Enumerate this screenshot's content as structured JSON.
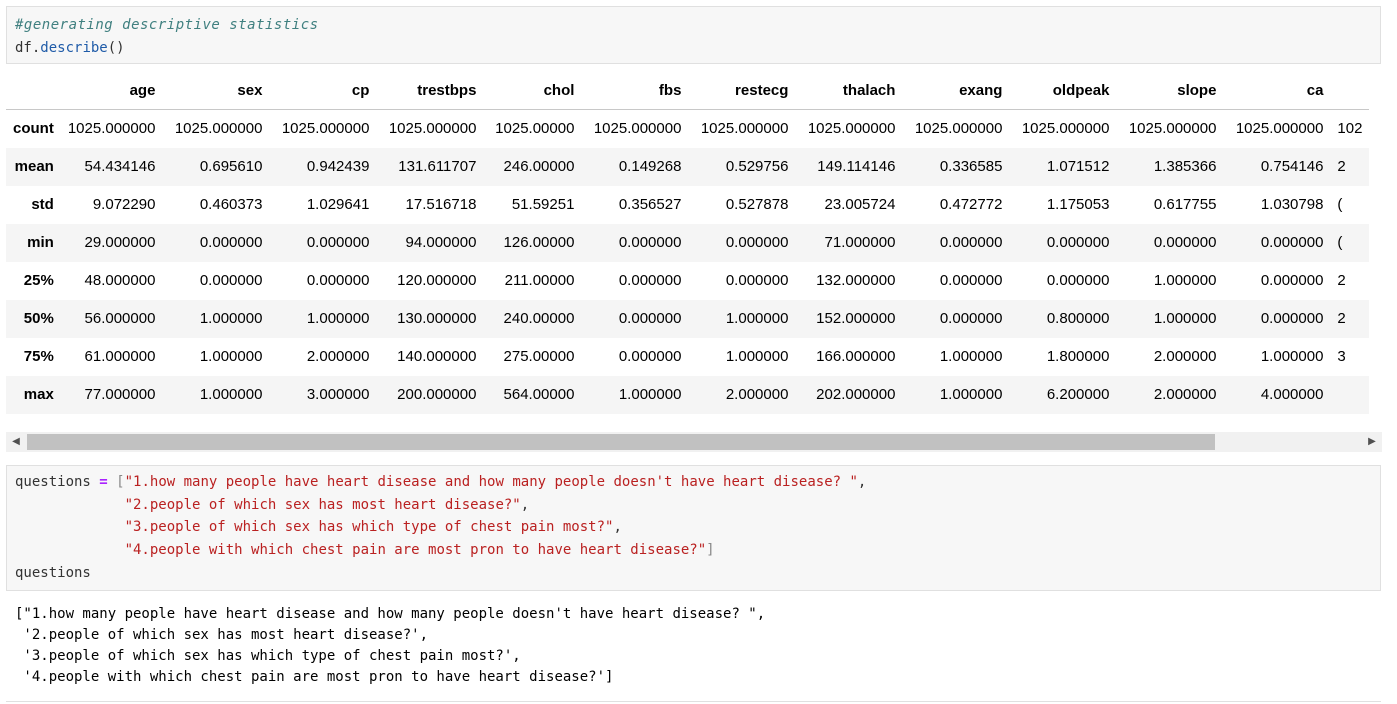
{
  "cell1": {
    "comment": "#generating descriptive statistics",
    "code_obj": "df.",
    "code_method": "describe",
    "code_paren": "()"
  },
  "table": {
    "columns": [
      "age",
      "sex",
      "cp",
      "trestbps",
      "chol",
      "fbs",
      "restecg",
      "thalach",
      "exang",
      "oldpeak",
      "slope",
      "ca"
    ],
    "rows": [
      {
        "label": "count",
        "values": [
          "1025.000000",
          "1025.000000",
          "1025.000000",
          "1025.000000",
          "1025.00000",
          "1025.000000",
          "1025.000000",
          "1025.000000",
          "1025.000000",
          "1025.000000",
          "1025.000000",
          "1025.000000"
        ],
        "extra": "102"
      },
      {
        "label": "mean",
        "values": [
          "54.434146",
          "0.695610",
          "0.942439",
          "131.611707",
          "246.00000",
          "0.149268",
          "0.529756",
          "149.114146",
          "0.336585",
          "1.071512",
          "1.385366",
          "0.754146"
        ],
        "extra": "2"
      },
      {
        "label": "std",
        "values": [
          "9.072290",
          "0.460373",
          "1.029641",
          "17.516718",
          "51.59251",
          "0.356527",
          "0.527878",
          "23.005724",
          "0.472772",
          "1.175053",
          "0.617755",
          "1.030798"
        ],
        "extra": "("
      },
      {
        "label": "min",
        "values": [
          "29.000000",
          "0.000000",
          "0.000000",
          "94.000000",
          "126.00000",
          "0.000000",
          "0.000000",
          "71.000000",
          "0.000000",
          "0.000000",
          "0.000000",
          "0.000000"
        ],
        "extra": "("
      },
      {
        "label": "25%",
        "values": [
          "48.000000",
          "0.000000",
          "0.000000",
          "120.000000",
          "211.00000",
          "0.000000",
          "0.000000",
          "132.000000",
          "0.000000",
          "0.000000",
          "1.000000",
          "0.000000"
        ],
        "extra": "2"
      },
      {
        "label": "50%",
        "values": [
          "56.000000",
          "1.000000",
          "1.000000",
          "130.000000",
          "240.00000",
          "0.000000",
          "1.000000",
          "152.000000",
          "0.000000",
          "0.800000",
          "1.000000",
          "0.000000"
        ],
        "extra": "2"
      },
      {
        "label": "75%",
        "values": [
          "61.000000",
          "1.000000",
          "2.000000",
          "140.000000",
          "275.00000",
          "0.000000",
          "1.000000",
          "166.000000",
          "1.000000",
          "1.800000",
          "2.000000",
          "1.000000"
        ],
        "extra": "3"
      },
      {
        "label": "max",
        "values": [
          "77.000000",
          "1.000000",
          "3.000000",
          "200.000000",
          "564.00000",
          "1.000000",
          "2.000000",
          "202.000000",
          "1.000000",
          "6.200000",
          "2.000000",
          "4.000000"
        ],
        "extra": ""
      }
    ]
  },
  "cell2": {
    "var": "questions",
    "op": "=",
    "open_bracket": "[",
    "close_bracket": "]",
    "items": [
      "\"1.how many people have heart disease and how many people doesn't have heart disease? \"",
      "\"2.people of which sex has most heart disease?\"",
      "\"3.people of which sex has which type of chest pain most?\"",
      "\"4.people with which chest pain are most pron to have heart disease?\""
    ],
    "last_line": "questions"
  },
  "output2": [
    "[\"1.how many people have heart disease and how many people doesn't have heart disease? \",",
    " '2.people of which sex has most heart disease?',",
    " '3.people of which sex has which type of chest pain most?',",
    " '4.people with which chest pain are most pron to have heart disease?']"
  ],
  "icons": {
    "left_arrow": "scroll-left-icon",
    "right_arrow": "scroll-right-icon"
  }
}
